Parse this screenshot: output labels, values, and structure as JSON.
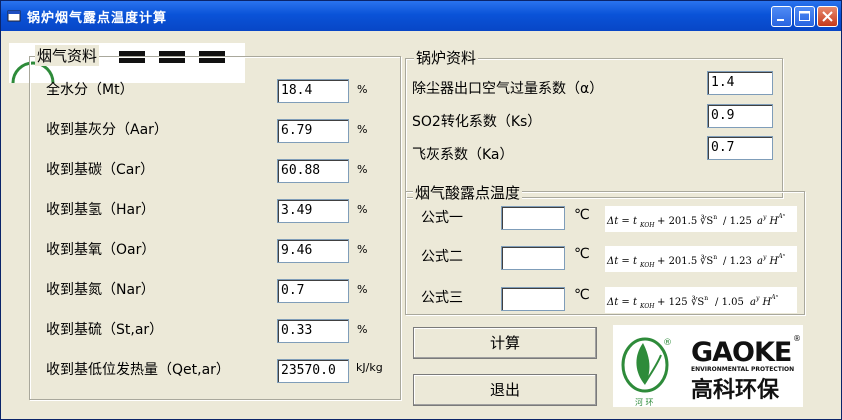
{
  "window": {
    "title": "锅炉烟气露点温度计算"
  },
  "flue_gas_data": {
    "legend": "烟气资料",
    "fields": [
      {
        "label": "全水分（Mt）",
        "value": "18.4",
        "unit": "%"
      },
      {
        "label": "收到基灰分（Aar）",
        "value": "6.79",
        "unit": "%"
      },
      {
        "label": "收到基碳（Car）",
        "value": "60.88",
        "unit": "%"
      },
      {
        "label": "收到基氢（Har）",
        "value": "3.49",
        "unit": "%"
      },
      {
        "label": "收到基氧（Oar）",
        "value": "9.46",
        "unit": "%"
      },
      {
        "label": "收到基氮（Nar）",
        "value": "0.7",
        "unit": "%"
      },
      {
        "label": "收到基硫（St,ar）",
        "value": "0.33",
        "unit": "%"
      },
      {
        "label": "收到基低位发热量（Qet,ar）",
        "value": "23570.0",
        "unit": "kJ/kg"
      }
    ]
  },
  "boiler_data": {
    "legend": "锅炉资料",
    "fields": [
      {
        "label": "除尘器出口空气过量系数（α）",
        "value": "1.4"
      },
      {
        "label": "SO2转化系数（Ks）",
        "value": "0.9"
      },
      {
        "label": "飞灰系数（Ka）",
        "value": "0.7"
      }
    ]
  },
  "dew_point": {
    "legend": "烟气酸露点温度",
    "formulas": [
      {
        "label": "公式一",
        "value": "",
        "unit": "℃",
        "coef": "201.5",
        "denom": "1.25"
      },
      {
        "label": "公式二",
        "value": "",
        "unit": "℃",
        "coef": "201.5",
        "denom": "1.23"
      },
      {
        "label": "公式三",
        "value": "",
        "unit": "℃",
        "coef": "125",
        "denom": "1.05"
      }
    ]
  },
  "buttons": {
    "calculate": "计算",
    "exit": "退出"
  },
  "logo": {
    "brand_latin": "GAOKE",
    "brand_sub": "ENVIRONMENTAL PROTECTION",
    "brand_cn": "高科环保",
    "badge_text": "河 环",
    "registered": "®"
  },
  "colors": {
    "title_bar": "#0A53D8",
    "logo_green": "#2E8B3A",
    "window_bg": "#ECE9D8"
  }
}
